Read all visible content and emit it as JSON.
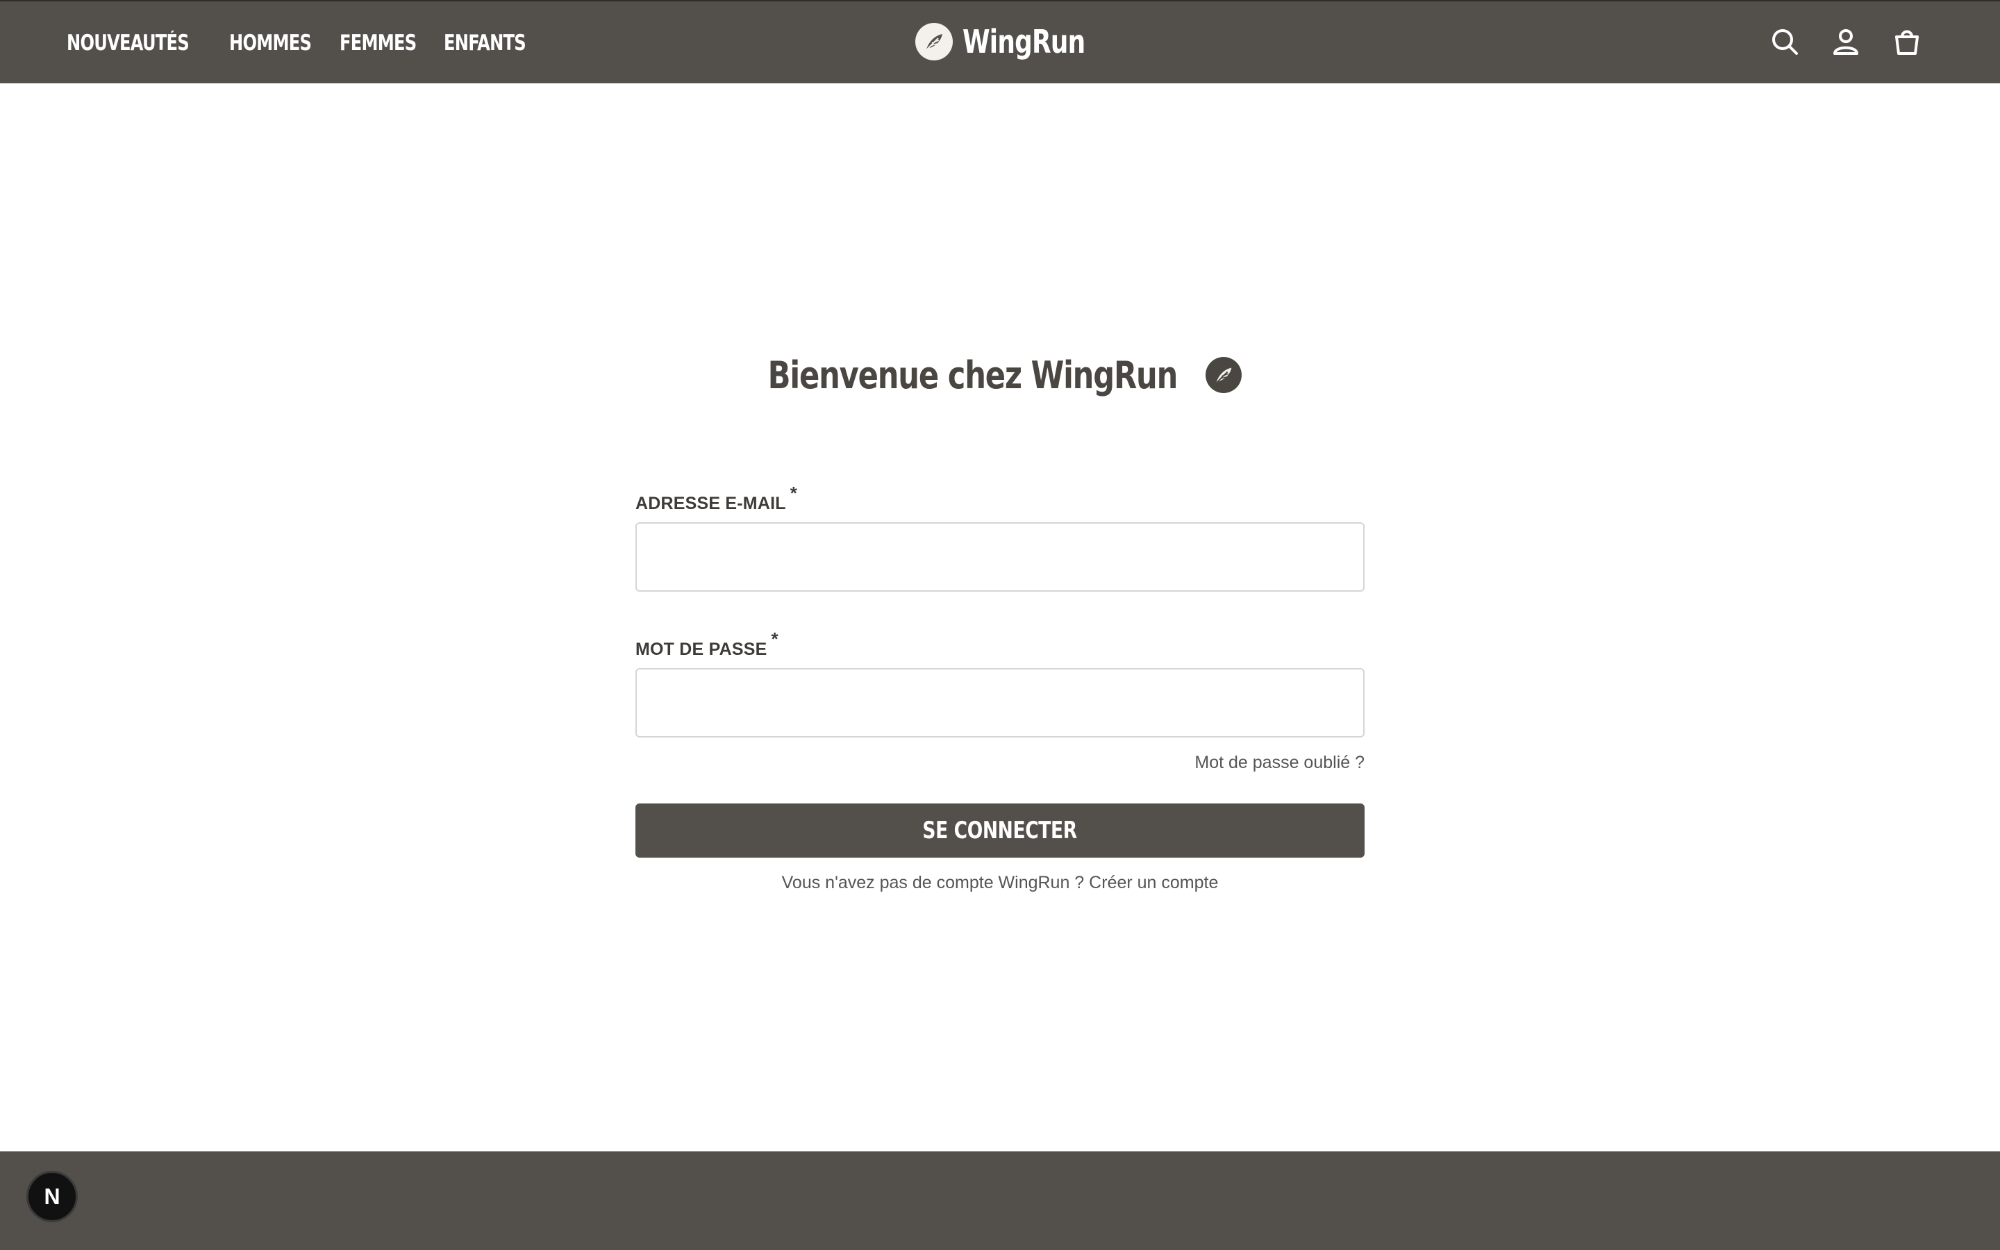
{
  "header": {
    "nav": [
      {
        "label": "NOUVEAUTÉS"
      },
      {
        "label": "HOMMES"
      },
      {
        "label": "FEMMES"
      },
      {
        "label": "ENFANTS"
      }
    ],
    "brand": "WingRun",
    "icons": [
      "search-icon",
      "user-icon",
      "shopping-bag-icon"
    ]
  },
  "login": {
    "title": "Bienvenue chez WingRun",
    "email_label": "ADRESSE E-MAIL",
    "password_label": "MOT DE PASSE",
    "required_mark": "*",
    "email_value": "",
    "password_value": "",
    "forgot_link": "Mot de passe oublié ?",
    "submit_label": "SE CONNECTER",
    "no_account_text": "Vous n'avez pas de compte WingRun ?",
    "create_account_link": "Créer un compte"
  },
  "dev_badge": {
    "letter": "N"
  },
  "colors": {
    "header_bg": "#534f4a",
    "accent": "#534f4a",
    "text": "#4a4642"
  }
}
